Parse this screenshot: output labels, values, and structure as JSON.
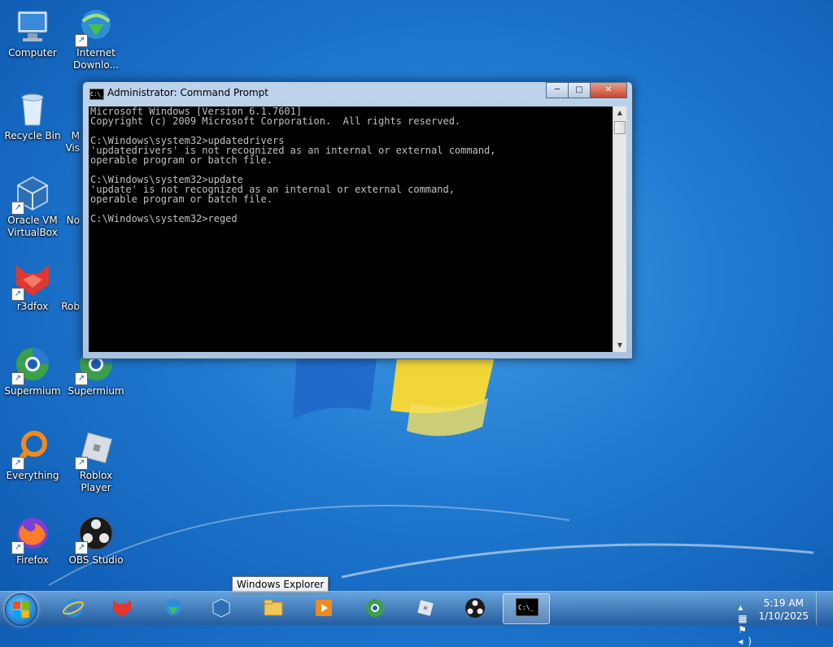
{
  "desktop": {
    "icons": [
      {
        "label": "Computer",
        "icon": "computer-icon"
      },
      {
        "label": "Internet Downlo...",
        "icon": "internet-download-manager-icon"
      },
      {
        "label": "Recycle Bin",
        "icon": "recycle-bin-icon"
      },
      {
        "label": "Oracle VM VirtualBox",
        "icon": "virtualbox-icon"
      },
      {
        "label": "r3dfox",
        "icon": "r3dfox-icon"
      },
      {
        "label": "Supermium",
        "icon": "supermium-icon"
      },
      {
        "label": "Supermium",
        "icon": "supermium-icon"
      },
      {
        "label": "Everything",
        "icon": "everything-icon"
      },
      {
        "label": "Roblox Player",
        "icon": "roblox-icon"
      },
      {
        "label": "Firefox",
        "icon": "firefox-icon"
      },
      {
        "label": "OBS Studio",
        "icon": "obs-icon"
      }
    ],
    "partial_labels": [
      "M",
      "Vis",
      "No",
      "Rob"
    ]
  },
  "window": {
    "title": "Administrator: Command Prompt",
    "icon_text": "C:\\_",
    "buttons": {
      "minimize": "─",
      "maximize": "□",
      "close": "✕"
    },
    "console_lines": [
      "Microsoft Windows [Version 6.1.7601]",
      "Copyright (c) 2009 Microsoft Corporation.  All rights reserved.",
      "",
      "C:\\Windows\\system32>updatedrivers",
      "'updatedrivers' is not recognized as an internal or external command,",
      "operable program or batch file.",
      "",
      "C:\\Windows\\system32>update",
      "'update' is not recognized as an internal or external command,",
      "operable program or batch file.",
      "",
      "C:\\Windows\\system32>reged"
    ],
    "console_colors": {
      "background": "#000000",
      "text": "#c0c0c0"
    }
  },
  "taskbar": {
    "items": [
      {
        "name": "internet-explorer-icon"
      },
      {
        "name": "r3dfox-icon"
      },
      {
        "name": "internet-download-manager-icon"
      },
      {
        "name": "virtualbox-icon"
      },
      {
        "name": "windows-explorer-icon"
      },
      {
        "name": "media-player-icon"
      },
      {
        "name": "supermium-icon"
      },
      {
        "name": "roblox-icon"
      },
      {
        "name": "obs-icon"
      },
      {
        "name": "command-prompt-icon",
        "active": true
      }
    ],
    "tooltip": "Windows Explorer",
    "clock": {
      "time": "5:19 AM",
      "date": "1/10/2025"
    },
    "tray_icons": [
      "chevron-up-icon",
      "network-icon",
      "action-center-flag-icon",
      "volume-icon"
    ]
  }
}
